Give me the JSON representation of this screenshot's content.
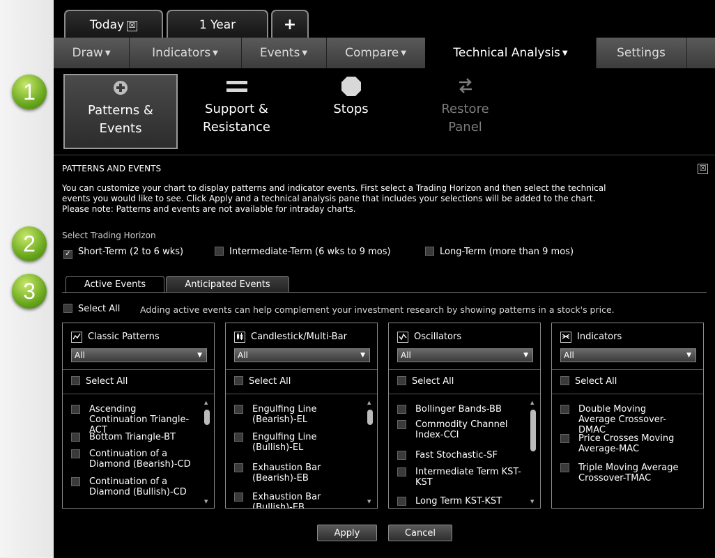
{
  "window_tabs": [
    {
      "label": "Today",
      "close_glyph": "☒"
    },
    {
      "label": "1 Year"
    },
    {
      "label": "+"
    }
  ],
  "menu": [
    {
      "label": "Draw"
    },
    {
      "label": "Indicators"
    },
    {
      "label": "Events"
    },
    {
      "label": "Compare"
    },
    {
      "label": "Technical Analysis"
    },
    {
      "label": "Settings"
    }
  ],
  "toolbar": {
    "patterns": {
      "line1": "Patterns &",
      "line2": "Events",
      "icon": "plus-circle-icon"
    },
    "support": {
      "line1": "Support &",
      "line2": "Resistance",
      "icon": "equals-icon"
    },
    "stops": {
      "line1": "Stops",
      "icon": "octagon-stop-icon"
    },
    "restore": {
      "line1": "Restore",
      "line2": "Panel",
      "icon": "swap-arrows-icon"
    }
  },
  "panel": {
    "title": "PATTERNS AND EVENTS",
    "close": "☒",
    "intro1": "You can customize your chart to display patterns and indicator events. First select a Trading Horizon and then select the technical",
    "intro2": "events you would like to see. Click Apply and a technical analysis pane that includes your selections will be added to the chart.",
    "intro3": "Please note: Patterns and events are not available for intraday charts.",
    "horizon_label": "Select Trading Horizon",
    "horizons": [
      {
        "label": "Short-Term (2 to 6 wks)",
        "checked": true
      },
      {
        "label": "Intermediate-Term (6 wks to 9 mos)",
        "checked": false
      },
      {
        "label": "Long-Term (more than 9 mos)",
        "checked": false
      }
    ],
    "tabs": [
      {
        "label": "Active Events"
      },
      {
        "label": "Anticipated Events"
      }
    ],
    "select_all": "Select All",
    "note": "Adding active events can help complement your investment research by showing patterns in a stock's price.",
    "columns": [
      {
        "title": "Classic Patterns",
        "icon": "line-chart-icon",
        "dropdown": "All",
        "select_all": "Select All",
        "items": [
          "Ascending Continuation Triangle-ACT",
          "Bottom Triangle-BT",
          "Continuation of a Diamond (Bearish)-CD",
          "Continuation of a Diamond (Bullish)-CD"
        ]
      },
      {
        "title": "Candlestick/Multi-Bar",
        "icon": "candlestick-icon",
        "dropdown": "All",
        "select_all": "Select All",
        "items": [
          "Engulfing Line (Bearish)-EL",
          "Engulfing Line (Bullish)-EL",
          "Exhaustion Bar (Bearish)-EB",
          "Exhaustion Bar (Bullish)-EB"
        ]
      },
      {
        "title": "Oscillators",
        "icon": "oscillator-icon",
        "dropdown": "All",
        "select_all": "Select All",
        "items": [
          "Bollinger Bands-BB",
          "Commodity Channel Index-CCI",
          "Fast Stochastic-SF",
          "Intermediate Term KST-KST",
          "Long Term KST-KST"
        ]
      },
      {
        "title": "Indicators",
        "icon": "crossover-icon",
        "dropdown": "All",
        "select_all": "Select All",
        "items": [
          "Double Moving Average Crossover-DMAC",
          "Price Crosses Moving Average-MAC",
          "Triple Moving Average Crossover-TMAC"
        ]
      }
    ],
    "apply": "Apply",
    "cancel": "Cancel"
  },
  "badges": [
    "1",
    "2",
    "3"
  ],
  "colors": {
    "badge_green": "#6aa81e",
    "background": "#000000",
    "menu_bar": "#4a4a4a"
  }
}
